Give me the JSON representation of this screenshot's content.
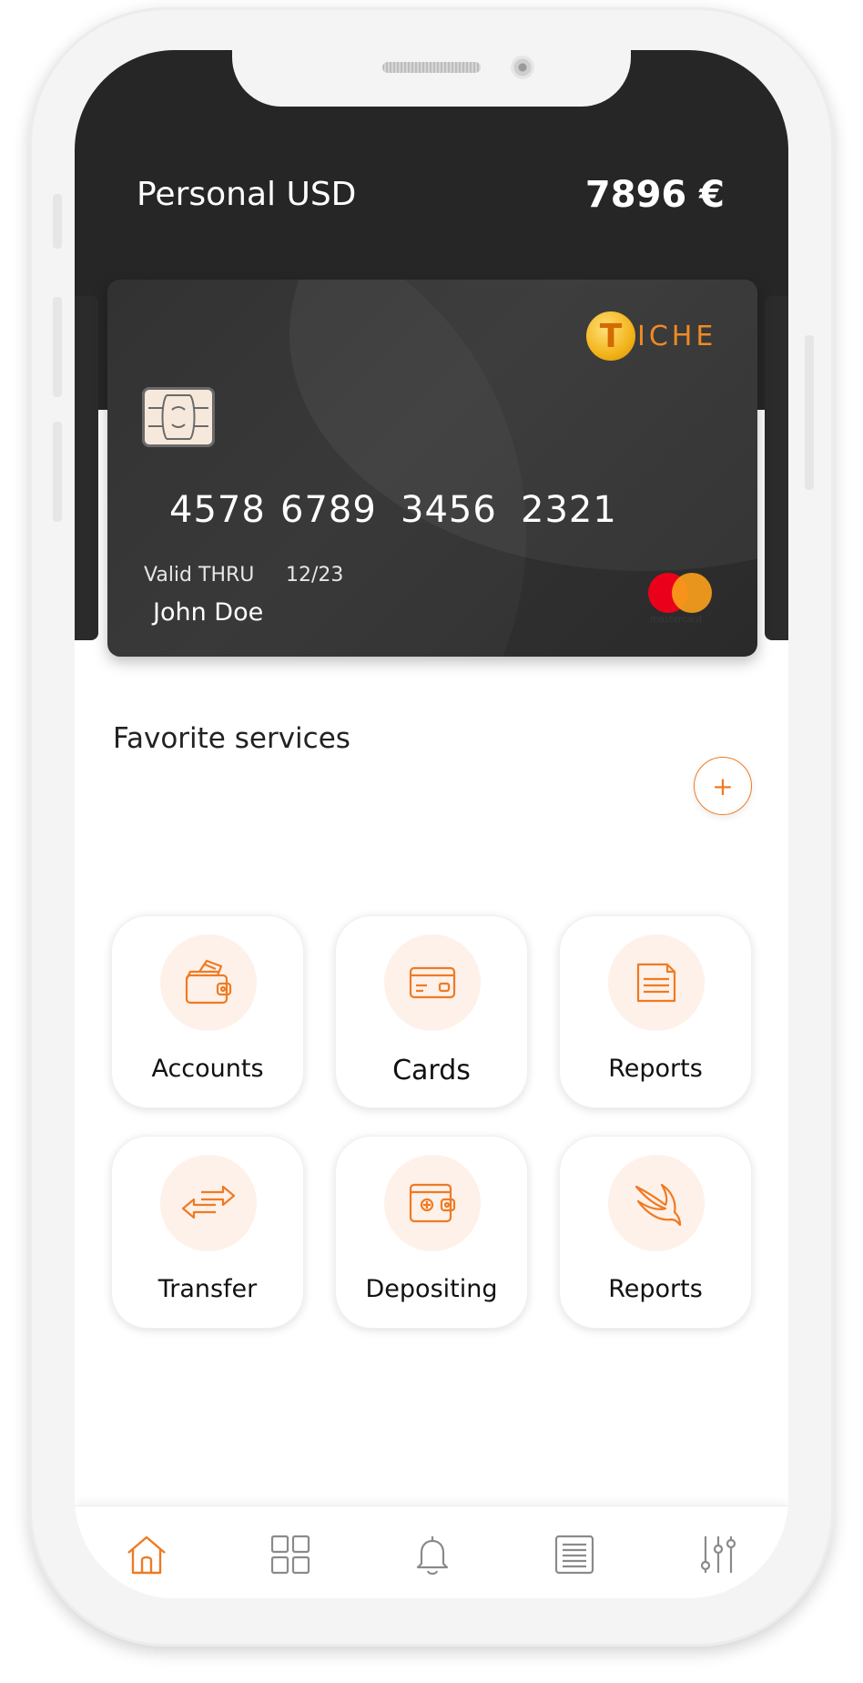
{
  "account": {
    "name": "Personal USD",
    "balance": "7896 €"
  },
  "card": {
    "brand_logo": {
      "letter": "T",
      "text": "ICHE"
    },
    "number_groups": [
      "4578",
      "6789",
      "3456",
      "2321"
    ],
    "valid_label": "Valid THRU",
    "valid_date": "12/23",
    "holder": "John Doe",
    "network": "mastercard"
  },
  "favorites": {
    "title": "Favorite services",
    "add_label": "+",
    "items": [
      {
        "label": "Accounts",
        "icon": "wallet-cards-icon"
      },
      {
        "label": "Cards",
        "icon": "credit-card-icon"
      },
      {
        "label": "Reports",
        "icon": "document-icon"
      },
      {
        "label": "Transfer",
        "icon": "transfer-arrows-icon"
      },
      {
        "label": "Depositing",
        "icon": "deposit-wallet-icon"
      },
      {
        "label": "Reports",
        "icon": "swift-bird-icon"
      }
    ]
  },
  "tabbar": {
    "items": [
      {
        "name": "home",
        "icon": "home-icon",
        "active": true
      },
      {
        "name": "apps",
        "icon": "grid-icon",
        "active": false
      },
      {
        "name": "notifications",
        "icon": "bell-icon",
        "active": false
      },
      {
        "name": "statements",
        "icon": "list-document-icon",
        "active": false
      },
      {
        "name": "settings",
        "icon": "sliders-icon",
        "active": false
      }
    ]
  },
  "colors": {
    "accent": "#f07a22",
    "header_bg": "#262626",
    "icon_bg": "#fdf1ea",
    "tab_inactive": "#8a8a8a"
  }
}
